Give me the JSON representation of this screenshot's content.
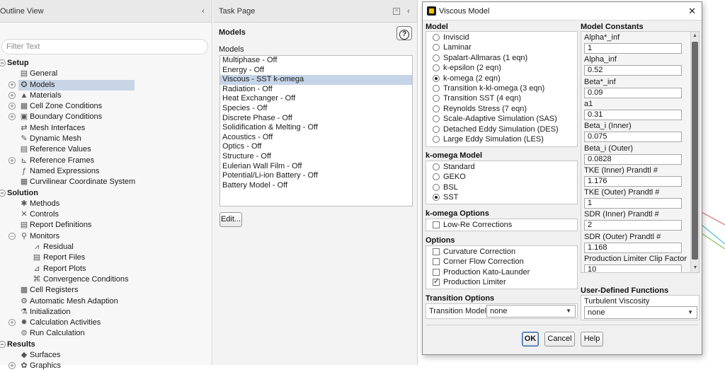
{
  "outline": {
    "title": "Outline View",
    "filter_placeholder": "Filter Text",
    "tree": [
      {
        "label": "Setup",
        "level": 0,
        "exp": "−",
        "icon": "",
        "section": true
      },
      {
        "label": "General",
        "level": 1,
        "exp": "",
        "icon": "general-icon",
        "glyph": "▤"
      },
      {
        "label": "Models",
        "level": 1,
        "exp": "+",
        "icon": "models-icon",
        "glyph": "✪",
        "selected": true
      },
      {
        "label": "Materials",
        "level": 1,
        "exp": "+",
        "icon": "materials-icon",
        "glyph": "▲"
      },
      {
        "label": "Cell Zone Conditions",
        "level": 1,
        "exp": "+",
        "icon": "cell-zone-icon",
        "glyph": "▦"
      },
      {
        "label": "Boundary Conditions",
        "level": 1,
        "exp": "+",
        "icon": "boundary-icon",
        "glyph": "▣"
      },
      {
        "label": "Mesh Interfaces",
        "level": 1,
        "exp": "",
        "icon": "mesh-interfaces-icon",
        "glyph": "⇄"
      },
      {
        "label": "Dynamic Mesh",
        "level": 1,
        "exp": "",
        "icon": "dynamic-mesh-icon",
        "glyph": "✎"
      },
      {
        "label": "Reference Values",
        "level": 1,
        "exp": "",
        "icon": "reference-values-icon",
        "glyph": "▤"
      },
      {
        "label": "Reference Frames",
        "level": 1,
        "exp": "+",
        "icon": "reference-frames-icon",
        "glyph": "⊾"
      },
      {
        "label": "Named Expressions",
        "level": 1,
        "exp": "",
        "icon": "named-expressions-icon",
        "glyph": "ƒ"
      },
      {
        "label": "Curvilinear Coordinate System",
        "level": 1,
        "exp": "",
        "icon": "curvilinear-icon",
        "glyph": "▦"
      },
      {
        "label": "Solution",
        "level": 0,
        "exp": "−",
        "icon": "",
        "section": true
      },
      {
        "label": "Methods",
        "level": 1,
        "exp": "",
        "icon": "methods-icon",
        "glyph": "✱"
      },
      {
        "label": "Controls",
        "level": 1,
        "exp": "",
        "icon": "controls-icon",
        "glyph": "✕"
      },
      {
        "label": "Report Definitions",
        "level": 1,
        "exp": "",
        "icon": "report-definitions-icon",
        "glyph": "▤"
      },
      {
        "label": "Monitors",
        "level": 1,
        "exp": "−",
        "icon": "monitors-icon",
        "glyph": "⚲"
      },
      {
        "label": "Residual",
        "level": 2,
        "exp": "",
        "icon": "residual-icon",
        "glyph": "⩘"
      },
      {
        "label": "Report Files",
        "level": 2,
        "exp": "",
        "icon": "report-files-icon",
        "glyph": "▤"
      },
      {
        "label": "Report Plots",
        "level": 2,
        "exp": "",
        "icon": "report-plots-icon",
        "glyph": "⊿"
      },
      {
        "label": "Convergence Conditions",
        "level": 2,
        "exp": "",
        "icon": "convergence-icon",
        "glyph": "⌘"
      },
      {
        "label": "Cell Registers",
        "level": 1,
        "exp": "",
        "icon": "cell-registers-icon",
        "glyph": "▩"
      },
      {
        "label": "Automatic Mesh Adaption",
        "level": 1,
        "exp": "",
        "icon": "mesh-adaption-icon",
        "glyph": "⚙"
      },
      {
        "label": "Initialization",
        "level": 1,
        "exp": "",
        "icon": "initialization-icon",
        "glyph": "⚗"
      },
      {
        "label": "Calculation Activities",
        "level": 1,
        "exp": "+",
        "icon": "calculation-activities-icon",
        "glyph": "✸"
      },
      {
        "label": "Run Calculation",
        "level": 1,
        "exp": "",
        "icon": "run-calculation-icon",
        "glyph": "⊜"
      },
      {
        "label": "Results",
        "level": 0,
        "exp": "−",
        "icon": "",
        "section": true
      },
      {
        "label": "Surfaces",
        "level": 1,
        "exp": "",
        "icon": "surfaces-icon",
        "glyph": "◆"
      },
      {
        "label": "Graphics",
        "level": 1,
        "exp": "+",
        "icon": "graphics-icon",
        "glyph": "✿"
      }
    ]
  },
  "task": {
    "title": "Task Page",
    "heading": "Models",
    "list_label": "Models",
    "help": "?",
    "models": [
      "Multiphase - Off",
      "Energy - Off",
      "Viscous - SST k-omega",
      "Radiation - Off",
      "Heat Exchanger - Off",
      "Species - Off",
      "Discrete Phase - Off",
      "Solidification & Melting - Off",
      "Acoustics - Off",
      "Optics - Off",
      "Structure - Off",
      "Eulerian Wall Film - Off",
      "Potential/Li-ion Battery - Off",
      "Battery Model - Off"
    ],
    "selected_index": 2,
    "edit_label": "Edit..."
  },
  "dialog": {
    "title": "Viscous Model",
    "close": "✕",
    "model": {
      "title": "Model",
      "options": [
        "Inviscid",
        "Laminar",
        "Spalart-Allmaras (1 eqn)",
        "k-epsilon (2 eqn)",
        "k-omega (2 eqn)",
        "Transition k-kl-omega (3 eqn)",
        "Transition SST (4 eqn)",
        "Reynolds Stress (7 eqn)",
        "Scale-Adaptive Simulation (SAS)",
        "Detached Eddy Simulation (DES)",
        "Large Eddy Simulation (LES)"
      ],
      "selected": 4
    },
    "kw_model": {
      "title": "k-omega Model",
      "options": [
        "Standard",
        "GEKO",
        "BSL",
        "SST"
      ],
      "selected": 3
    },
    "kw_options": {
      "title": "k-omega Options",
      "items": [
        {
          "label": "Low-Re Corrections",
          "checked": false
        }
      ]
    },
    "options": {
      "title": "Options",
      "items": [
        {
          "label": "Curvature Correction",
          "checked": false
        },
        {
          "label": "Corner Flow Correction",
          "checked": false
        },
        {
          "label": "Production Kato-Launder",
          "checked": false
        },
        {
          "label": "Production Limiter",
          "checked": true
        }
      ]
    },
    "transition": {
      "title": "Transition Options",
      "label": "Transition Model",
      "value": "none"
    },
    "constants": {
      "title": "Model Constants",
      "items": [
        {
          "label": "Alpha*_inf",
          "value": "1"
        },
        {
          "label": "Alpha_inf",
          "value": "0.52"
        },
        {
          "label": "Beta*_inf",
          "value": "0.09"
        },
        {
          "label": "a1",
          "value": "0.31"
        },
        {
          "label": "Beta_i (Inner)",
          "value": "0.075"
        },
        {
          "label": "Beta_i (Outer)",
          "value": "0.0828"
        },
        {
          "label": "TKE (Inner) Prandtl #",
          "value": "1.176"
        },
        {
          "label": "TKE (Outer) Prandtl #",
          "value": "1"
        },
        {
          "label": "SDR (Inner) Prandtl #",
          "value": "2"
        },
        {
          "label": "SDR (Outer) Prandtl #",
          "value": "1.168"
        },
        {
          "label": "Production Limiter Clip Factor",
          "value": "10"
        }
      ]
    },
    "udf": {
      "title": "User-Defined Functions",
      "label": "Turbulent Viscosity",
      "value": "none"
    },
    "buttons": {
      "ok": "OK",
      "cancel": "Cancel",
      "help": "Help"
    }
  }
}
